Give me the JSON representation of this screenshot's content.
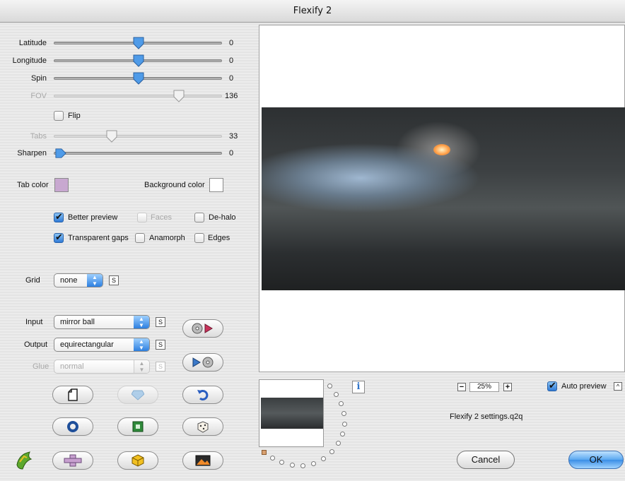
{
  "window": {
    "title": "Flexify 2"
  },
  "sliders": [
    {
      "label": "Latitude",
      "value": "0",
      "fraction": 0.5,
      "enabled": true
    },
    {
      "label": "Longitude",
      "value": "0",
      "fraction": 0.5,
      "enabled": true
    },
    {
      "label": "Spin",
      "value": "0",
      "fraction": 0.5,
      "enabled": true
    },
    {
      "label": "FOV",
      "value": "136",
      "fraction": 0.76,
      "enabled": false
    },
    {
      "label": "Tabs",
      "value": "33",
      "fraction": 0.33,
      "enabled": false
    },
    {
      "label": "Sharpen",
      "value": "0",
      "fraction": 0.0,
      "enabled": true
    }
  ],
  "flip": {
    "label": "Flip",
    "checked": false
  },
  "colors": {
    "tab_color_label": "Tab color",
    "tab_color": "#c8a8d0",
    "background_color_label": "Background color",
    "background_color": "#ffffff"
  },
  "options": {
    "better_preview": {
      "label": "Better preview",
      "checked": true
    },
    "faces": {
      "label": "Faces",
      "checked": false
    },
    "de_halo": {
      "label": "De-halo",
      "checked": false
    },
    "transparent_gaps": {
      "label": "Transparent gaps",
      "checked": true
    },
    "anamorph": {
      "label": "Anamorph",
      "checked": false
    },
    "edges": {
      "label": "Edges",
      "checked": false
    }
  },
  "grid": {
    "label": "Grid",
    "value": "none",
    "s": "S"
  },
  "input": {
    "label": "Input",
    "value": "mirror ball",
    "s": "S"
  },
  "output": {
    "label": "Output",
    "value": "equirectangular",
    "s": "S"
  },
  "glue": {
    "label": "Glue",
    "value": "normal",
    "s": "S"
  },
  "zoom": {
    "value": "25%",
    "minus": "−",
    "plus": "+"
  },
  "auto_preview": {
    "label": "Auto preview",
    "checked": true,
    "collapse": "^"
  },
  "settings_file": "Flexify 2 settings.q2q",
  "info": "i",
  "buttons": {
    "cancel": "Cancel",
    "ok": "OK"
  },
  "accent": "#3b8ee6"
}
